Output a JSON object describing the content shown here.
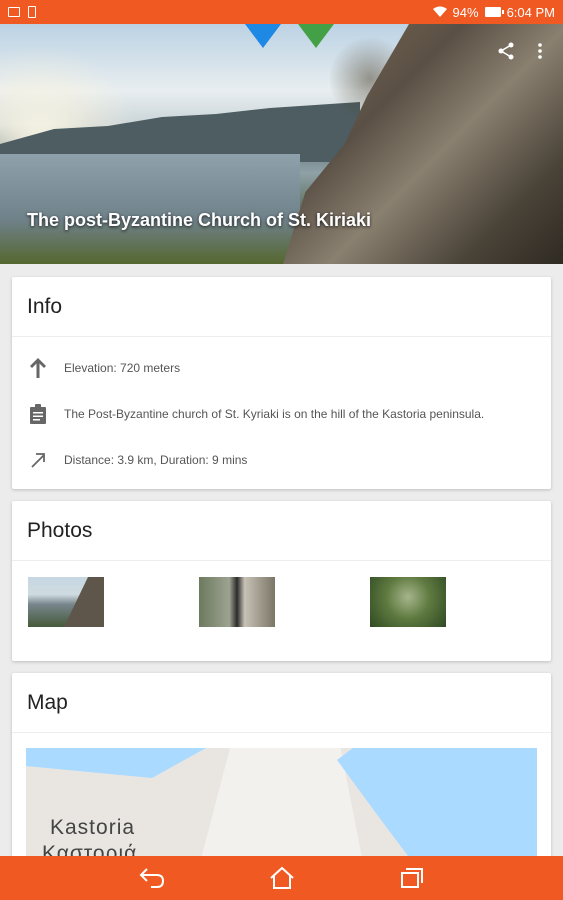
{
  "status_bar": {
    "battery": "94%",
    "time": "6:04 PM",
    "color": "#f05a22"
  },
  "hero": {
    "title": "The post-Byzantine Church of St. Kiriaki",
    "actions": [
      "share-icon",
      "more-vert-icon"
    ]
  },
  "info": {
    "title": "Info",
    "rows": [
      {
        "icon": "arrow-up-icon",
        "text": "Elevation: 720 meters"
      },
      {
        "icon": "clipboard-icon",
        "text": "The Post-Byzantine church of St. Kyriaki is on the hill of the Kastoria peninsula."
      },
      {
        "icon": "arrow-diagonal-icon",
        "text": "Distance: 3.9 km, Duration: 9 mins"
      }
    ]
  },
  "photos": {
    "title": "Photos",
    "count": 3
  },
  "map": {
    "title": "Map",
    "label": "Kastoria",
    "label_local": "Καστοριά"
  },
  "nav_bar": {
    "buttons": [
      "back-icon",
      "home-icon",
      "recents-icon"
    ]
  }
}
